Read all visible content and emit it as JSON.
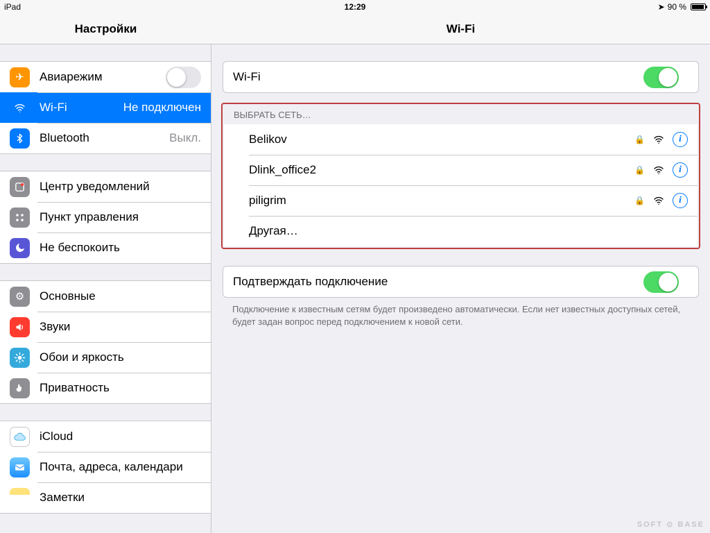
{
  "status": {
    "device": "iPad",
    "time": "12:29",
    "battery_pct": "90 %"
  },
  "header": {
    "left_title": "Настройки",
    "right_title": "Wi-Fi"
  },
  "sidebar": {
    "g1": [
      {
        "label": "Авиарежим",
        "status": "",
        "type": "toggle",
        "on": false
      },
      {
        "label": "Wi-Fi",
        "status": "Не подключен",
        "selected": true
      },
      {
        "label": "Bluetooth",
        "status": "Выкл."
      }
    ],
    "g2": [
      {
        "label": "Центр уведомлений"
      },
      {
        "label": "Пункт управления"
      },
      {
        "label": "Не беспокоить"
      }
    ],
    "g3": [
      {
        "label": "Основные"
      },
      {
        "label": "Звуки"
      },
      {
        "label": "Обои и яркость"
      },
      {
        "label": "Приватность"
      }
    ],
    "g4": [
      {
        "label": "iCloud"
      },
      {
        "label": "Почта, адреса, календари"
      },
      {
        "label": "Заметки"
      }
    ]
  },
  "content": {
    "wifi_toggle_label": "Wi-Fi",
    "choose_network_header": "ВЫБРАТЬ СЕТЬ…",
    "networks": [
      {
        "name": "Belikov",
        "locked": true
      },
      {
        "name": "Dlink_office2",
        "locked": true
      },
      {
        "name": "piligrim",
        "locked": true
      }
    ],
    "other_label": "Другая…",
    "ask_join_label": "Подтверждать подключение",
    "ask_join_footer": "Подключение к известным сетям будет произведено автоматически. Если нет известных доступных сетей, будет задан вопрос перед подключением к новой сети."
  },
  "watermark": "SOFT ⊙ BASE"
}
